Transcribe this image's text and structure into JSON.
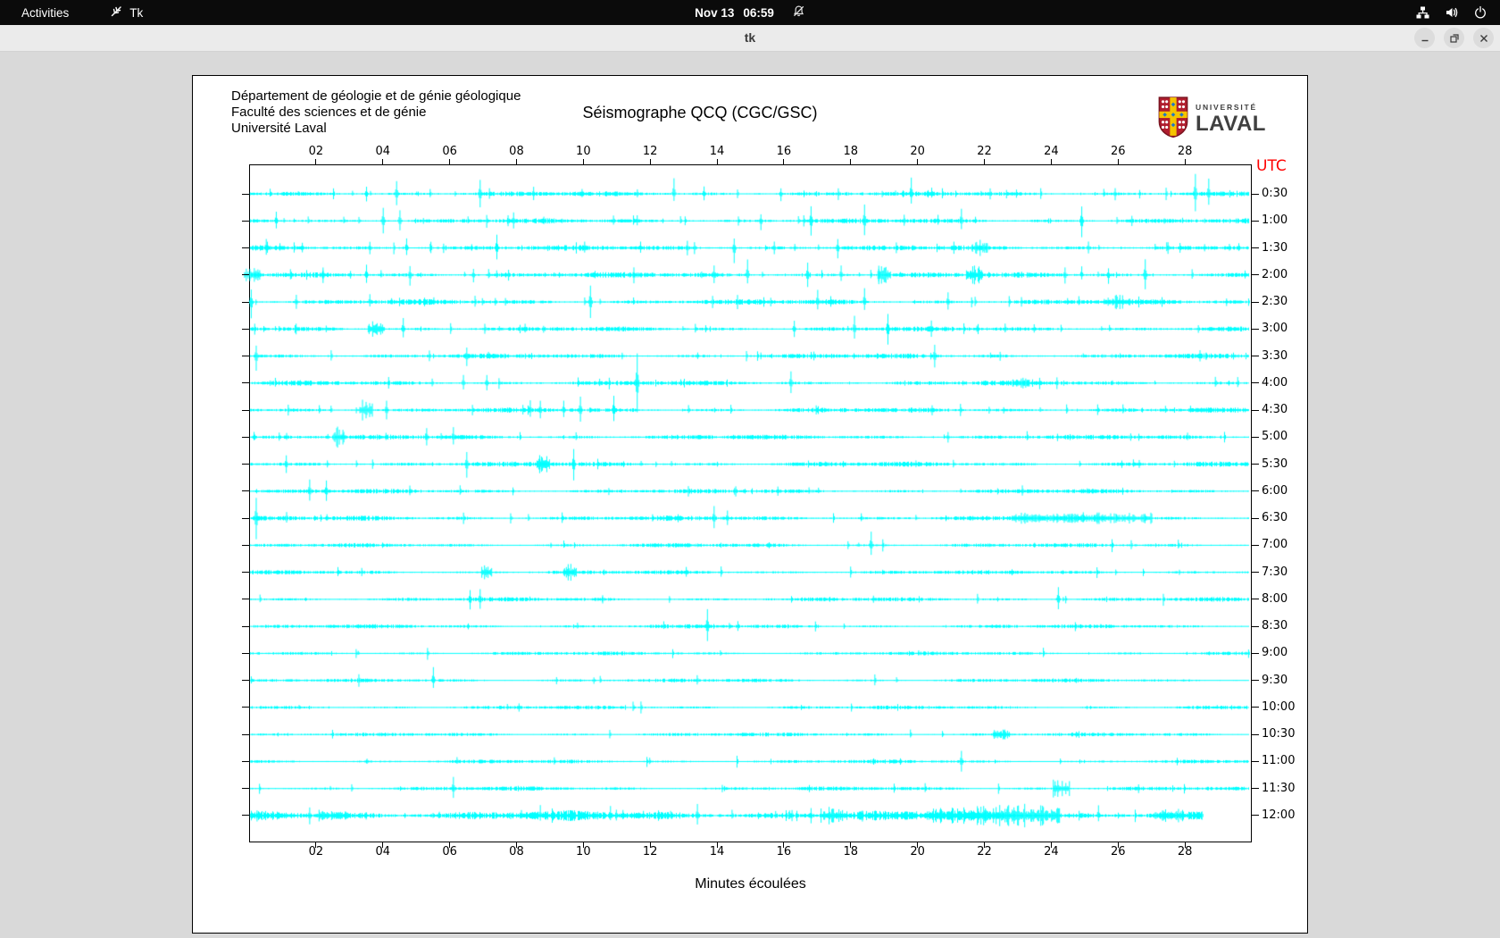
{
  "top_bar": {
    "activities_label": "Activities",
    "app_name": "Tk",
    "clock_date": "Nov 13",
    "clock_time": "06:59",
    "icons": [
      "tk-feather-icon",
      "notifications-disabled-icon",
      "network-wired-icon",
      "volume-icon",
      "power-icon"
    ]
  },
  "window": {
    "title": "tk",
    "buttons": [
      "minimize",
      "restore",
      "close"
    ]
  },
  "figure": {
    "header_lines": [
      "Département de géologie et de génie géologique",
      "Faculté des sciences et de génie",
      "Université Laval"
    ],
    "title": "Séismographe QCQ (CGC/GSC)",
    "logo": {
      "line1": "UNIVERSITÉ",
      "line2": "LAVAL"
    },
    "utc_label": "UTC",
    "xlabel": "Minutes écoulées"
  },
  "colors": {
    "trace": "#00ffff",
    "utc_red": "#ff0000",
    "topbar_bg": "#0b0b0b",
    "titlebar_bg": "#ebebeb",
    "window_bg": "#d9d9d9",
    "figure_bg": "#ffffff",
    "shield_red": "#b01e2f",
    "shield_gold": "#f5c400",
    "shield_blue": "#1e78c8"
  },
  "chart_data": {
    "type": "line",
    "subtype": "helicorder-seismogram",
    "title": "Séismographe QCQ (CGC/GSC)",
    "xlabel": "Minutes écoulées",
    "x_range": [
      0,
      30
    ],
    "x_ticks": [
      "02",
      "04",
      "06",
      "08",
      "10",
      "12",
      "14",
      "16",
      "18",
      "20",
      "22",
      "24",
      "26",
      "28"
    ],
    "right_axis_label": "UTC",
    "grid": false,
    "legend": "none",
    "seed": 1337,
    "rows": [
      {
        "time": "0:30",
        "noise": 1.2,
        "minor": 26,
        "events": [
          {
            "m": 3.5,
            "a": 9
          },
          {
            "m": 4.4,
            "a": 13
          },
          {
            "m": 6.9,
            "a": 15
          },
          {
            "m": 8.5,
            "a": 7
          },
          {
            "m": 12.7,
            "a": 14
          },
          {
            "m": 13.6,
            "a": 9
          },
          {
            "m": 15.9,
            "a": 7
          },
          {
            "m": 19.8,
            "a": 15
          },
          {
            "m": 25.9,
            "a": 7
          },
          {
            "m": 28.3,
            "a": 23
          },
          {
            "m": 28.7,
            "a": 19
          }
        ]
      },
      {
        "time": "1:00",
        "noise": 1.2,
        "minor": 24,
        "events": [
          {
            "m": 0.8,
            "a": 9
          },
          {
            "m": 4.0,
            "a": 16
          },
          {
            "m": 4.5,
            "a": 10
          },
          {
            "m": 7.9,
            "a": 11
          },
          {
            "m": 11.6,
            "a": 7
          },
          {
            "m": 15.3,
            "a": 9
          },
          {
            "m": 16.8,
            "a": 14
          },
          {
            "m": 18.4,
            "a": 17
          },
          {
            "m": 20.6,
            "a": 7
          },
          {
            "m": 21.3,
            "a": 11
          },
          {
            "m": 24.9,
            "a": 18
          }
        ]
      },
      {
        "time": "1:30",
        "noise": 1.3,
        "minor": 26,
        "events": [
          {
            "m": 0.5,
            "a": 8
          },
          {
            "m": 3.6,
            "a": 7
          },
          {
            "m": 4.7,
            "a": 14
          },
          {
            "m": 7.4,
            "a": 14
          },
          {
            "m": 11.7,
            "a": 9
          },
          {
            "m": 13.1,
            "a": 8
          },
          {
            "m": 14.5,
            "a": 14
          },
          {
            "m": 15.7,
            "a": 9
          },
          {
            "m": 17.6,
            "a": 12
          },
          {
            "m": 21.9,
            "a": 8,
            "w": 0.4
          },
          {
            "m": 25.1,
            "a": 7
          }
        ]
      },
      {
        "time": "2:00",
        "noise": 1.3,
        "minor": 28,
        "events": [
          {
            "m": 0.1,
            "a": 7,
            "w": 0.5
          },
          {
            "m": 2.2,
            "a": 10
          },
          {
            "m": 3.5,
            "a": 15
          },
          {
            "m": 4.8,
            "a": 10
          },
          {
            "m": 6.7,
            "a": 9
          },
          {
            "m": 11.5,
            "a": 9
          },
          {
            "m": 13.9,
            "a": 10
          },
          {
            "m": 14.9,
            "a": 14
          },
          {
            "m": 16.7,
            "a": 13
          },
          {
            "m": 17.7,
            "a": 9
          },
          {
            "m": 19.0,
            "a": 9,
            "w": 0.4
          },
          {
            "m": 21.7,
            "a": 9,
            "w": 0.5
          },
          {
            "m": 24.4,
            "a": 8
          },
          {
            "m": 24.9,
            "a": 8
          },
          {
            "m": 25.7,
            "a": 8
          },
          {
            "m": 26.8,
            "a": 16
          }
        ]
      },
      {
        "time": "2:30",
        "noise": 1.3,
        "minor": 24,
        "events": [
          {
            "m": 0.05,
            "a": 15
          },
          {
            "m": 1.4,
            "a": 9
          },
          {
            "m": 3.6,
            "a": 9
          },
          {
            "m": 10.2,
            "a": 16
          },
          {
            "m": 14.6,
            "a": 9
          },
          {
            "m": 17.0,
            "a": 15
          },
          {
            "m": 18.4,
            "a": 14
          },
          {
            "m": 20.9,
            "a": 9
          },
          {
            "m": 26.1,
            "a": 6,
            "w": 0.6
          }
        ]
      },
      {
        "time": "3:00",
        "noise": 1.2,
        "minor": 22,
        "events": [
          {
            "m": 3.8,
            "a": 8,
            "w": 0.5
          },
          {
            "m": 4.6,
            "a": 14
          },
          {
            "m": 16.3,
            "a": 9
          },
          {
            "m": 18.1,
            "a": 15
          },
          {
            "m": 19.1,
            "a": 14
          },
          {
            "m": 20.4,
            "a": 9
          },
          {
            "m": 21.8,
            "a": 6
          }
        ]
      },
      {
        "time": "3:30",
        "noise": 1.2,
        "minor": 18,
        "events": [
          {
            "m": 0.2,
            "a": 14
          },
          {
            "m": 6.5,
            "a": 9
          },
          {
            "m": 20.5,
            "a": 13
          }
        ]
      },
      {
        "time": "4:00",
        "noise": 1.2,
        "minor": 18,
        "events": [
          {
            "m": 6.4,
            "a": 11
          },
          {
            "m": 7.1,
            "a": 9
          },
          {
            "m": 11.6,
            "a": 27
          },
          {
            "m": 16.2,
            "a": 11
          },
          {
            "m": 23.1,
            "a": 6,
            "w": 0.5
          }
        ]
      },
      {
        "time": "4:30",
        "noise": 1.2,
        "minor": 20,
        "events": [
          {
            "m": 3.5,
            "a": 8,
            "w": 0.4
          },
          {
            "m": 4.1,
            "a": 9
          },
          {
            "m": 8.4,
            "a": 10
          },
          {
            "m": 8.7,
            "a": 9
          },
          {
            "m": 9.4,
            "a": 13
          },
          {
            "m": 9.9,
            "a": 15
          },
          {
            "m": 10.9,
            "a": 14
          }
        ]
      },
      {
        "time": "5:00",
        "noise": 1.2,
        "minor": 18,
        "events": [
          {
            "m": 2.7,
            "a": 8,
            "w": 0.4
          },
          {
            "m": 5.3,
            "a": 13
          },
          {
            "m": 6.1,
            "a": 13
          },
          {
            "m": 20.9,
            "a": 6
          }
        ]
      },
      {
        "time": "5:30",
        "noise": 1.2,
        "minor": 18,
        "events": [
          {
            "m": 1.1,
            "a": 10
          },
          {
            "m": 6.5,
            "a": 15
          },
          {
            "m": 8.8,
            "a": 8,
            "w": 0.4
          },
          {
            "m": 9.7,
            "a": 17
          },
          {
            "m": 26.1,
            "a": 5
          }
        ]
      },
      {
        "time": "6:00",
        "noise": 1.1,
        "minor": 14,
        "events": [
          {
            "m": 1.8,
            "a": 14
          },
          {
            "m": 2.3,
            "a": 13
          }
        ]
      },
      {
        "time": "6:30",
        "noise": 1.2,
        "minor": 14,
        "events": [
          {
            "m": 0.2,
            "a": 19
          },
          {
            "m": 13.9,
            "a": 13
          },
          {
            "m": 14.3,
            "a": 11
          },
          {
            "m": 24.9,
            "a": 5,
            "w": 4.2
          }
        ]
      },
      {
        "time": "7:00",
        "noise": 1.0,
        "minor": 10,
        "events": [
          {
            "m": 18.6,
            "a": 14
          }
        ]
      },
      {
        "time": "7:30",
        "noise": 1.0,
        "minor": 10,
        "events": [
          {
            "m": 7.1,
            "a": 7,
            "w": 0.3
          },
          {
            "m": 9.6,
            "a": 8,
            "w": 0.4
          }
        ]
      },
      {
        "time": "8:00",
        "noise": 1.0,
        "minor": 10,
        "events": [
          {
            "m": 6.6,
            "a": 11
          },
          {
            "m": 6.9,
            "a": 10
          },
          {
            "m": 24.2,
            "a": 13
          }
        ]
      },
      {
        "time": "8:30",
        "noise": 1.0,
        "minor": 8,
        "events": [
          {
            "m": 13.7,
            "a": 16
          }
        ]
      },
      {
        "time": "9:00",
        "noise": 0.9,
        "minor": 8,
        "events": []
      },
      {
        "time": "9:30",
        "noise": 0.9,
        "minor": 8,
        "events": [
          {
            "m": 5.5,
            "a": 14
          }
        ]
      },
      {
        "time": "10:00",
        "noise": 0.9,
        "minor": 7,
        "events": []
      },
      {
        "time": "10:30",
        "noise": 0.9,
        "minor": 7,
        "events": [
          {
            "m": 22.5,
            "a": 6,
            "w": 0.5
          }
        ]
      },
      {
        "time": "11:00",
        "noise": 0.9,
        "minor": 7,
        "events": [
          {
            "m": 21.3,
            "a": 14
          }
        ]
      },
      {
        "time": "11:30",
        "noise": 1.0,
        "minor": 8,
        "events": [
          {
            "m": 6.1,
            "a": 15
          },
          {
            "m": 24.3,
            "a": 7,
            "w": 0.5
          },
          {
            "m": 26.6,
            "a": 5
          }
        ]
      },
      {
        "time": "12:00",
        "noise": 2.4,
        "minor": 36,
        "end": 28.5,
        "events": [
          {
            "m": 1.8,
            "a": 8
          },
          {
            "m": 2.5,
            "a": 6,
            "w": 1.0
          },
          {
            "m": 8.7,
            "a": 10
          },
          {
            "m": 10.8,
            "a": 9
          },
          {
            "m": 13.4,
            "a": 13
          },
          {
            "m": 16.8,
            "a": 9
          },
          {
            "m": 17.5,
            "a": 7,
            "w": 0.8
          },
          {
            "m": 21.0,
            "a": 7,
            "w": 1.5
          },
          {
            "m": 23.0,
            "a": 9,
            "w": 2.5
          },
          {
            "m": 25.4,
            "a": 10
          },
          {
            "m": 27.5,
            "a": 6,
            "w": 0.8
          }
        ]
      }
    ]
  }
}
